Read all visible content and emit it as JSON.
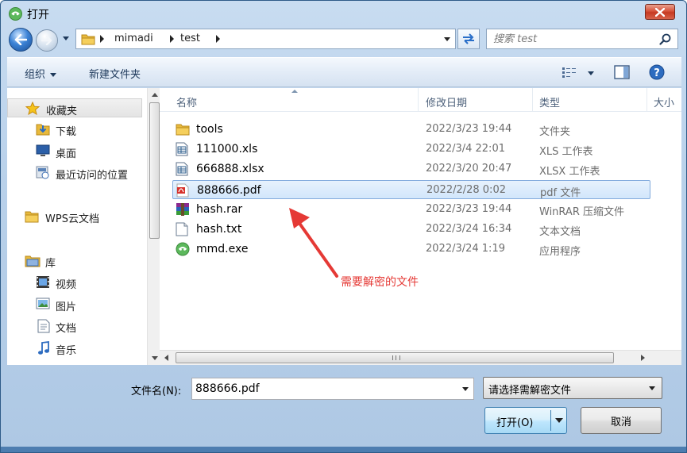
{
  "window": {
    "title": "打开"
  },
  "address": {
    "crumbs": [
      "mimadi",
      "test"
    ],
    "search_placeholder": "搜索 test"
  },
  "toolbar": {
    "organize": "组织",
    "new_folder": "新建文件夹"
  },
  "nav": {
    "favorites": "收藏夹",
    "downloads": "下载",
    "desktop": "桌面",
    "recent": "最近访问的位置",
    "wps": "WPS云文档",
    "libraries": "库",
    "videos": "视频",
    "pictures": "图片",
    "documents": "文档",
    "music": "音乐"
  },
  "columns": {
    "name": "名称",
    "date": "修改日期",
    "type": "类型",
    "size": "大小"
  },
  "files": [
    {
      "name": "tools",
      "date": "2022/3/23 19:44",
      "type": "文件夹",
      "icon": "folder-icon"
    },
    {
      "name": "111000.xls",
      "date": "2022/3/4 22:01",
      "type": "XLS 工作表",
      "icon": "xls-file-icon"
    },
    {
      "name": "666888.xlsx",
      "date": "2022/3/20 20:47",
      "type": "XLSX 工作表",
      "icon": "xlsx-file-icon"
    },
    {
      "name": "888666.pdf",
      "date": "2022/2/28 0:02",
      "type": "pdf 文件",
      "icon": "pdf-file-icon"
    },
    {
      "name": "hash.rar",
      "date": "2022/3/23 19:44",
      "type": "WinRAR 压缩文件",
      "icon": "rar-file-icon"
    },
    {
      "name": "hash.txt",
      "date": "2022/3/24 16:34",
      "type": "文本文档",
      "icon": "txt-file-icon"
    },
    {
      "name": "mmd.exe",
      "date": "2022/3/24 1:19",
      "type": "应用程序",
      "icon": "exe-file-icon"
    }
  ],
  "selected_file_index": 3,
  "annotation": {
    "text": "需要解密的文件"
  },
  "bottom": {
    "filename_label": "文件名(N):",
    "filename_value": "888666.pdf",
    "filter_label": "请选择需解密文件",
    "open_label": "打开(O)",
    "cancel_label": "取消"
  },
  "colors": {
    "selection_border": "#84acdd",
    "annotation_red": "#e53935",
    "close_button": "#c63a22"
  }
}
